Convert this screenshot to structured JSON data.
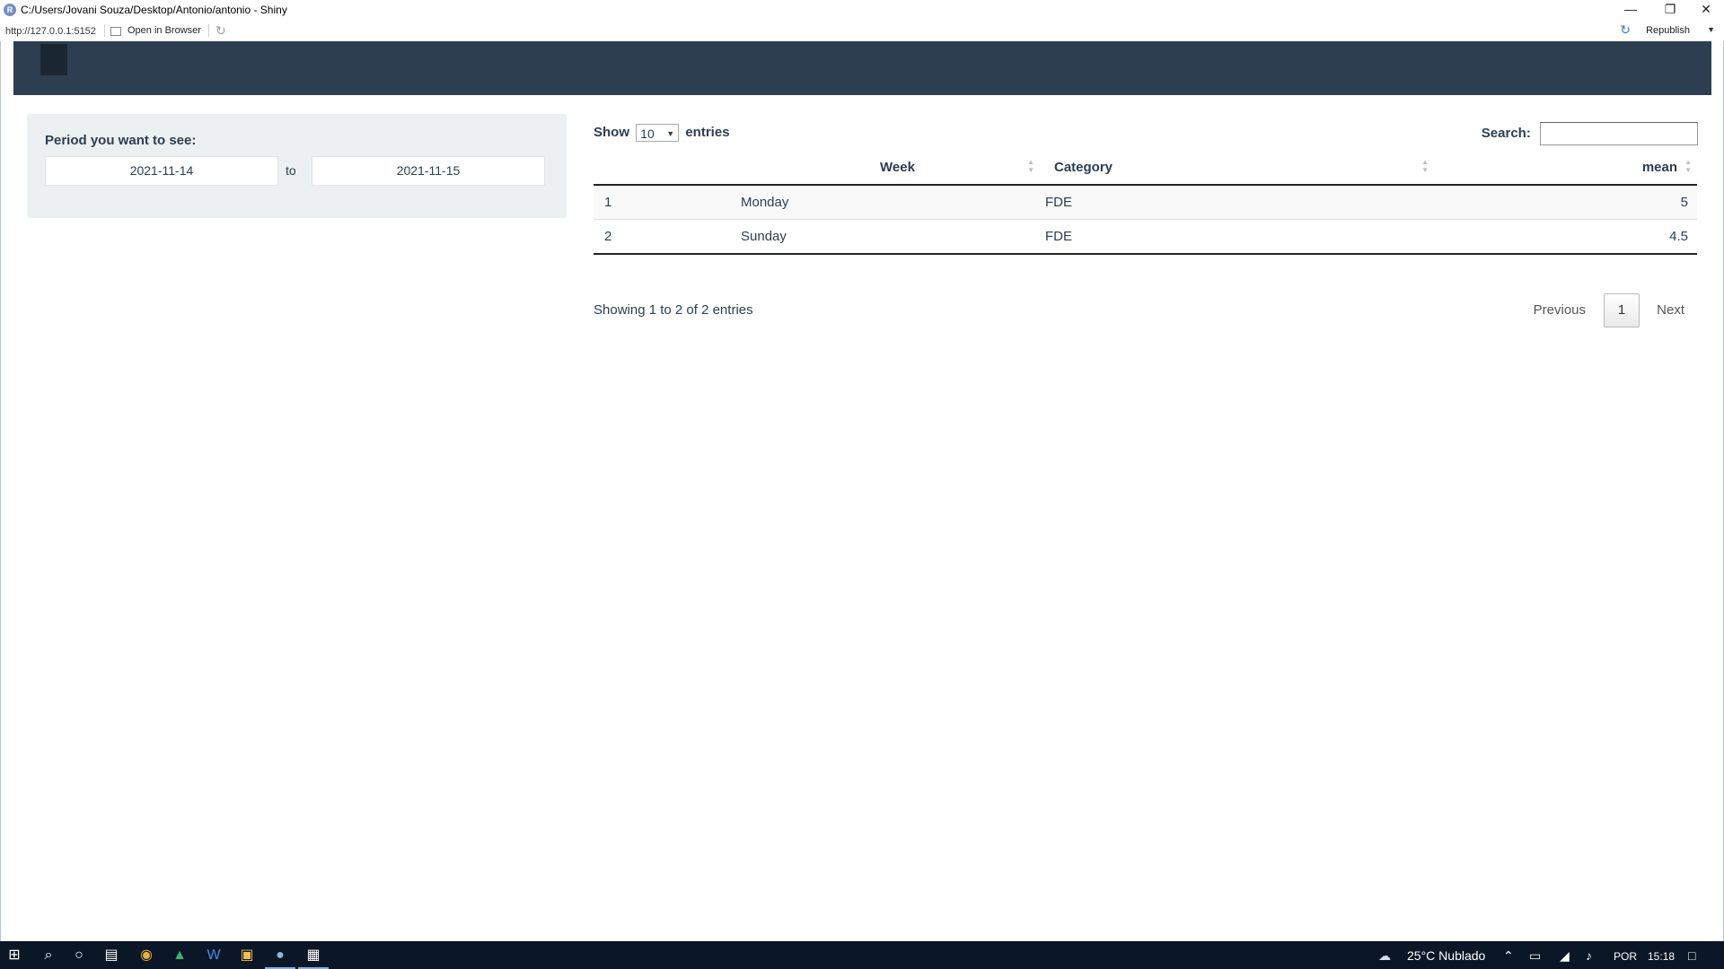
{
  "window": {
    "title": "C:/Users/Jovani Souza/Desktop/Antonio/antonio - Shiny",
    "app_icon": "R",
    "minimize": "—",
    "restore": "❐",
    "close": "✕"
  },
  "toolbar": {
    "url": "http://127.0.0.1:5152",
    "open_in_browser": "Open in Browser",
    "republish": "Republish"
  },
  "sidebar": {
    "period_label": "Period you want to see:",
    "start_date": "2021-11-14",
    "to_label": "to",
    "end_date": "2021-11-15"
  },
  "datatable": {
    "show_label": "Show",
    "page_length": "10",
    "entries_label": "entries",
    "search_label": "Search:",
    "columns": [
      "",
      "Week",
      "Category",
      "mean"
    ],
    "rows": [
      {
        "index": "1",
        "week": "Monday",
        "category": "FDE",
        "mean": "5"
      },
      {
        "index": "2",
        "week": "Sunday",
        "category": "FDE",
        "mean": "4.5"
      }
    ],
    "info": "Showing 1 to 2 of 2 entries",
    "previous": "Previous",
    "current_page": "1",
    "next": "Next"
  },
  "taskbar": {
    "weather": "25°C  Nublado",
    "language": "POR",
    "time": "15:18"
  },
  "colors": {
    "navbar": "#2c3e50",
    "well": "#ecf0f1",
    "taskbar": "#0b1626"
  }
}
